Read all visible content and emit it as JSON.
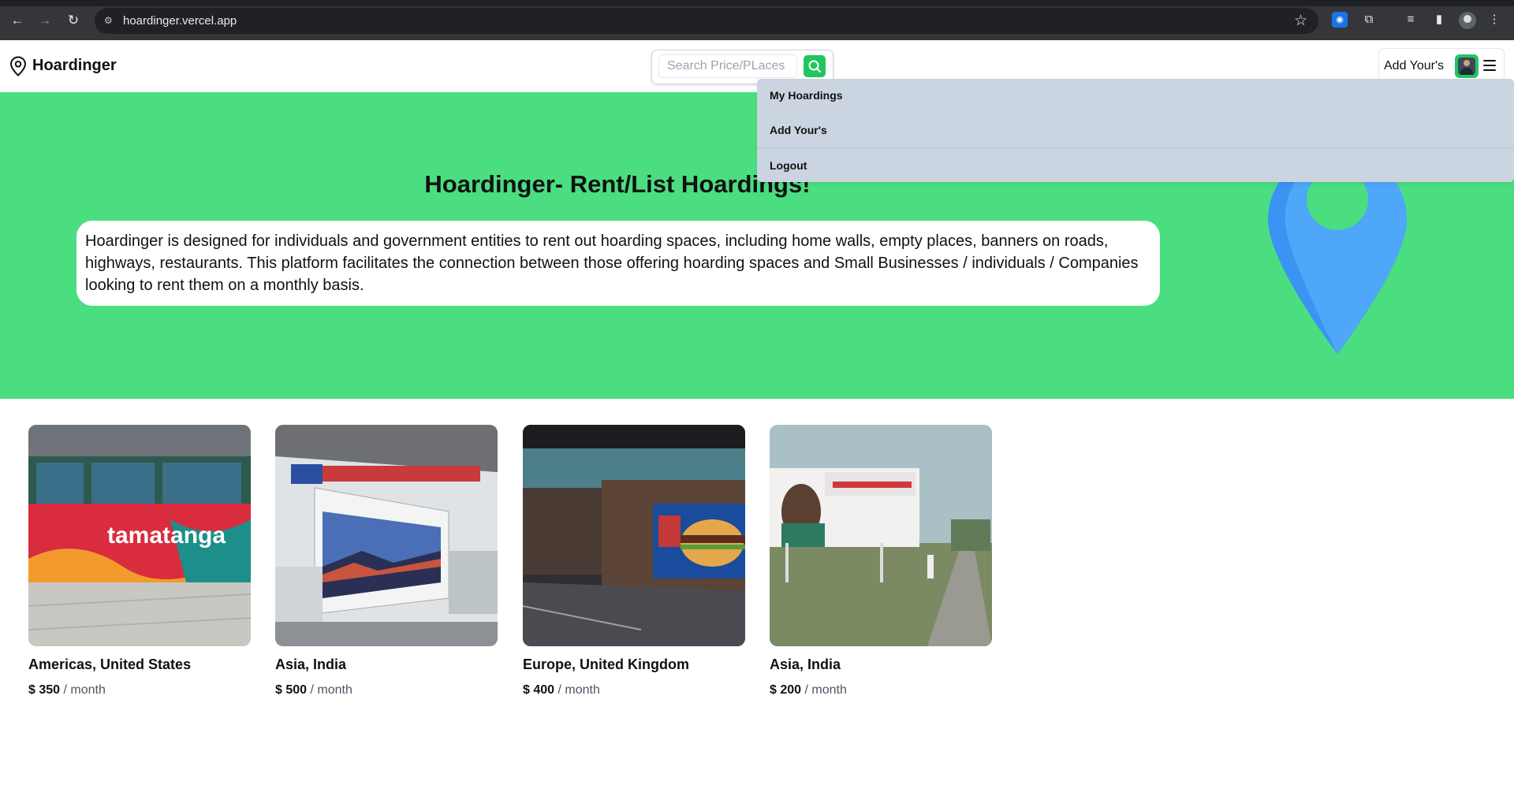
{
  "browser": {
    "url": "hoardinger.vercel.app"
  },
  "header": {
    "brand": "Hoardinger",
    "search": {
      "placeholder": "Search Price/PLaces"
    },
    "add_yours": "Add Your's"
  },
  "dropdown": {
    "items": [
      "My Hoardings",
      "Add Your's",
      "Logout"
    ]
  },
  "hero": {
    "title": "Hoardinger- Rent/List Hoardings!",
    "description": "Hoardinger is designed for individuals and government entities to rent out hoarding spaces, including home walls, empty places, banners on roads, highways, restaurants. This platform facilitates the connection between those offering hoarding spaces and Small Businesses / individuals / Companies looking to rent them on a monthly basis.",
    "pin_color": "#4ea7f9"
  },
  "listings": [
    {
      "location": "Americas, United States",
      "price": "$ 350",
      "per": "/ month"
    },
    {
      "location": "Asia, India",
      "price": "$ 500",
      "per": "/ month"
    },
    {
      "location": "Europe, United Kingdom",
      "price": "$ 400",
      "per": "/ month"
    },
    {
      "location": "Asia, India",
      "price": "$ 200",
      "per": "/ month"
    }
  ],
  "colors": {
    "accent_green": "#22c55e",
    "hero_green": "#4ade80",
    "dropdown_bg": "#cbd5e1"
  }
}
